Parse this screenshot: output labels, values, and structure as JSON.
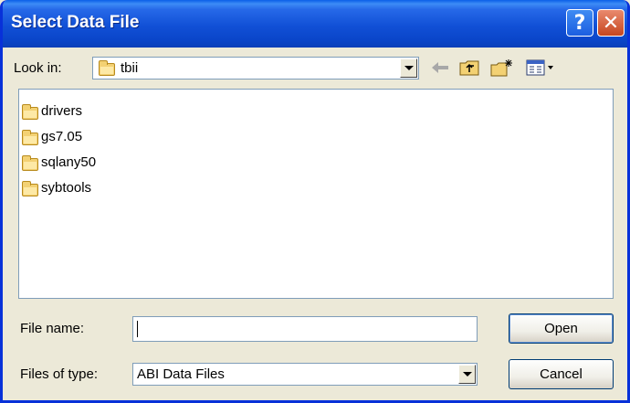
{
  "window": {
    "title": "Select Data File",
    "help_glyph": "?",
    "close_glyph": "✕"
  },
  "look_in": {
    "label": "Look in:",
    "value": "tbii",
    "icon": "folder-icon"
  },
  "toolbar": {
    "back_icon": "back-arrow-icon",
    "up_icon": "up-one-level-icon",
    "new_folder_icon": "new-folder-icon",
    "view_icon": "view-menu-icon"
  },
  "files": [
    {
      "name": "drivers"
    },
    {
      "name": "gs7.05"
    },
    {
      "name": "sqlany50"
    },
    {
      "name": "sybtools"
    }
  ],
  "file_name": {
    "label": "File name:",
    "value": ""
  },
  "file_type": {
    "label": "Files of type:",
    "value": "ABI Data Files"
  },
  "buttons": {
    "open": "Open",
    "cancel": "Cancel"
  },
  "colors": {
    "titlebar": "#0a45c9",
    "dialog_bg": "#ece9d8",
    "folder": "#f3d173"
  }
}
